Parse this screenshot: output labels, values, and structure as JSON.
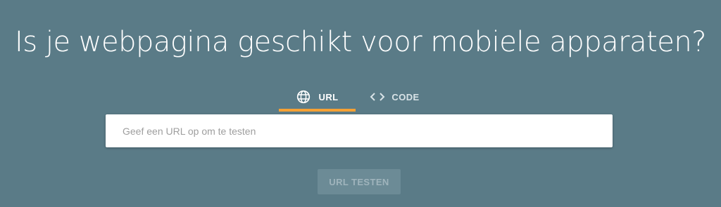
{
  "page": {
    "title": "Is je webpagina geschikt voor mobiele apparaten?"
  },
  "tabs": [
    {
      "label": "URL",
      "icon": "globe-icon",
      "active": true
    },
    {
      "label": "CODE",
      "icon": "code-icon",
      "active": false
    }
  ],
  "url_input": {
    "placeholder": "Geef een URL op om te testen",
    "value": ""
  },
  "test_button": {
    "label": "URL TESTEN",
    "disabled": true
  },
  "colors": {
    "background": "#5a7b87",
    "tab_indicator": "#f5a134",
    "input_background": "#ffffff"
  }
}
